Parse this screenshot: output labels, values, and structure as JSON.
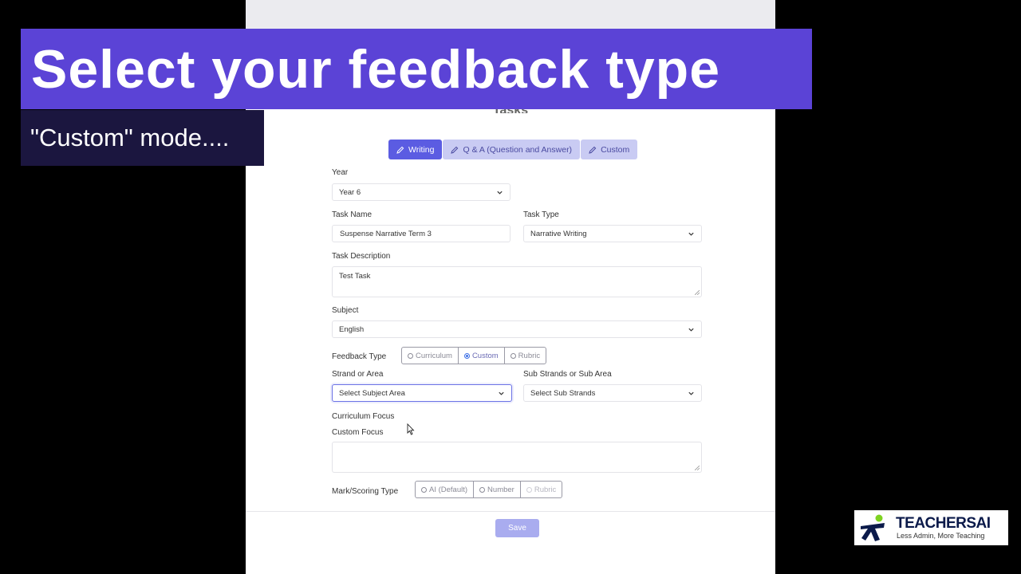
{
  "overlay": {
    "headline": "Select your feedback type",
    "subheadline": "\"Custom\" mode...."
  },
  "page": {
    "title": "Tasks"
  },
  "tabs": [
    {
      "label": "Writing",
      "active": true,
      "icon": "pencil-icon"
    },
    {
      "label": "Q & A (Question and Answer)",
      "active": false,
      "icon": "pencil-icon"
    },
    {
      "label": "Custom",
      "active": false,
      "icon": "pencil-icon"
    }
  ],
  "form": {
    "year": {
      "label": "Year",
      "value": "Year 6"
    },
    "task_name": {
      "label": "Task Name",
      "value": "Suspense Narrative Term 3"
    },
    "task_type": {
      "label": "Task Type",
      "value": "Narrative Writing"
    },
    "task_description": {
      "label": "Task Description",
      "value": "Test Task"
    },
    "subject": {
      "label": "Subject",
      "value": "English"
    },
    "feedback_type": {
      "label": "Feedback Type",
      "options": [
        "Curriculum",
        "Custom",
        "Rubric"
      ],
      "selected": "Custom"
    },
    "strand": {
      "label": "Strand or Area",
      "placeholder": "Select Subject Area"
    },
    "sub_strand": {
      "label": "Sub Strands or Sub Area",
      "placeholder": "Select Sub Strands"
    },
    "curriculum_focus": {
      "label": "Curriculum Focus"
    },
    "custom_focus": {
      "label": "Custom Focus",
      "value": ""
    },
    "scoring_type": {
      "label": "Mark/Scoring Type",
      "options": [
        "AI (Default)",
        "Number",
        "Rubric"
      ]
    },
    "save_label": "Save"
  },
  "logo": {
    "name": "TEACHERSAI",
    "tagline": "Less Admin, More Teaching",
    "colors": {
      "navy": "#0b1a4a",
      "green": "#7ed321"
    }
  },
  "colors": {
    "banner": "#5b43d6",
    "subbanner": "#1b163f",
    "accent": "#5b5ce2",
    "tab_inactive": "#c9cbf3",
    "save": "#a9acef"
  }
}
